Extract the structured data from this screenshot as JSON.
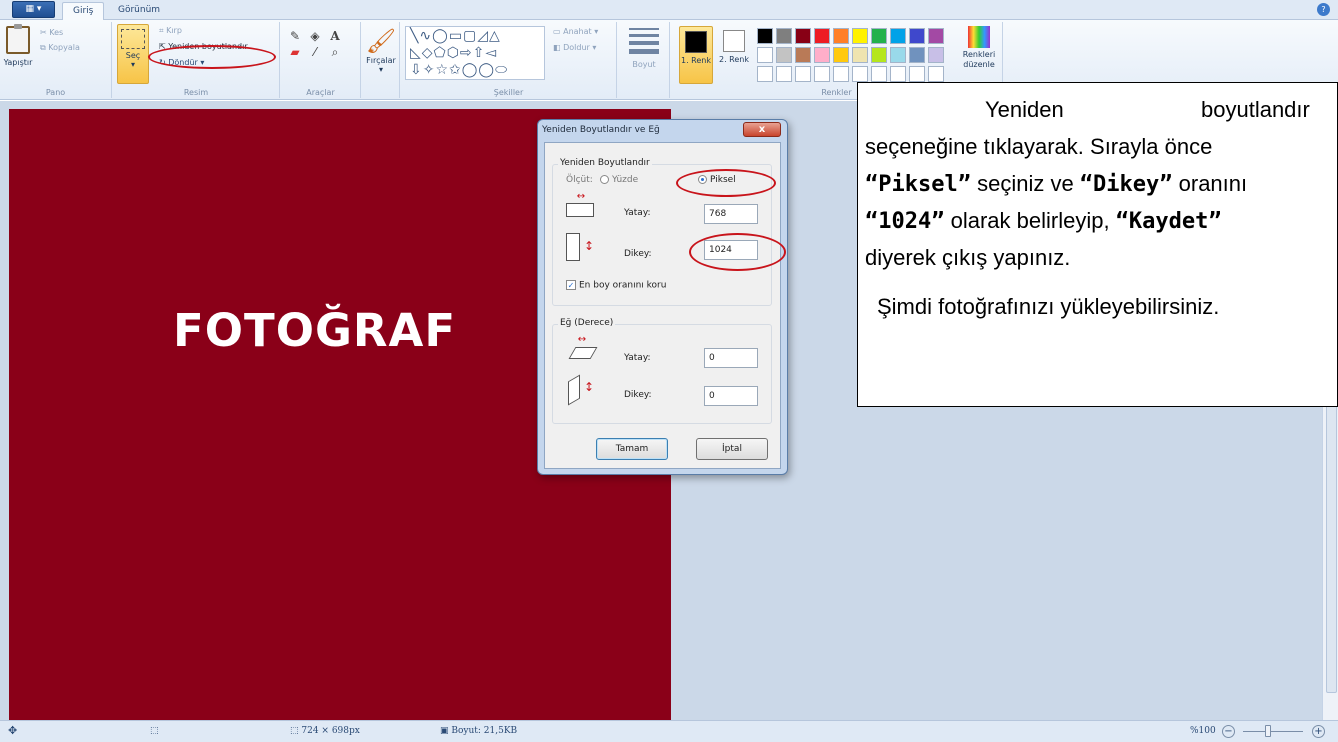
{
  "tabs": {
    "menu_label": "▦ ▾",
    "home": "Giriş",
    "view": "Görünüm"
  },
  "ribbon": {
    "pano": {
      "paste": "Yapıştır",
      "cut": "Kes",
      "copy": "Kopyala",
      "label": "Pano"
    },
    "resim": {
      "select": "Seç",
      "crop": "Kırp",
      "resize": "Yeniden boyutlandır",
      "rotate": "Döndür ▾",
      "label": "Resim"
    },
    "araclar": {
      "label": "Araçlar"
    },
    "brushes": {
      "label": "Fırçalar"
    },
    "sekiller": {
      "shapes_glyphs": "╲∿◯▭▢◿△\n◺◇⬠⬡⇨⇧◅\n⇩✧☆✩◯◯⬭",
      "outline": "Anahat ▾",
      "fill": "Doldur ▾",
      "label": "Şekiller"
    },
    "size": {
      "label": "Boyut"
    },
    "renkler": {
      "color1": "1. Renk",
      "color2": "2. Renk",
      "edit_colors": "Renkleri düzenle",
      "label": "Renkler"
    }
  },
  "palette": {
    "row1": [
      "#000000",
      "#7f7f7f",
      "#880015",
      "#ed1c24",
      "#ff7f27",
      "#fff200",
      "#22b14c",
      "#00a2e8",
      "#3f48cc",
      "#a349a4"
    ],
    "row2": [
      "#ffffff",
      "#c3c3c3",
      "#b97a57",
      "#ffaec9",
      "#ffc90e",
      "#efe4b0",
      "#b5e61d",
      "#99d9ea",
      "#7092be",
      "#c8bfe7"
    ],
    "row3": [
      "#ffffff",
      "#ffffff",
      "#ffffff",
      "#ffffff",
      "#ffffff",
      "#ffffff",
      "#ffffff",
      "#ffffff",
      "#ffffff",
      "#ffffff"
    ]
  },
  "canvas": {
    "text": "FOTOĞRAF",
    "color": "#8a0018"
  },
  "dialog": {
    "title": "Yeniden Boyutlandır ve Eğ",
    "close": "x",
    "resize_group": "Yeniden Boyutlandır",
    "by": "Ölçüt:",
    "percent": "Yüzde",
    "pixel": "Piksel",
    "horizontal": "Yatay:",
    "vertical": "Dikey:",
    "width_value": "768",
    "height_value": "1024",
    "keep_ratio": "En boy oranını koru",
    "skew_group": "Eğ (Derece)",
    "skew_h_value": "0",
    "skew_v_value": "0",
    "ok": "Tamam",
    "cancel": "İptal"
  },
  "callout": {
    "w1": "Yeniden",
    "w2": "boyutlandır",
    "line2": "seçeneğine tıklayarak. Sırayla önce",
    "piksel": "“Piksel”",
    "line3_mid": " seçiniz ve ",
    "dikey": "“Dikey”",
    "line3_end": " oranını",
    "value": "“1024”",
    "line4_mid": " olarak belirleyip, ",
    "kaydet": "“Kaydet”",
    "line5": "diyerek çıkış yapınız.",
    "line6": "Şimdi fotoğrafınızı yükleyebilirsiniz."
  },
  "status": {
    "move": "✥",
    "selection": "⬚",
    "dims": "724 × 698px",
    "size": "Boyut: 21,5KB",
    "zoom": "%100",
    "zoom_out": "−",
    "zoom_in": "+"
  },
  "colors": {
    "highlight": "#c8141b",
    "workspace": "#cbd8e8"
  }
}
